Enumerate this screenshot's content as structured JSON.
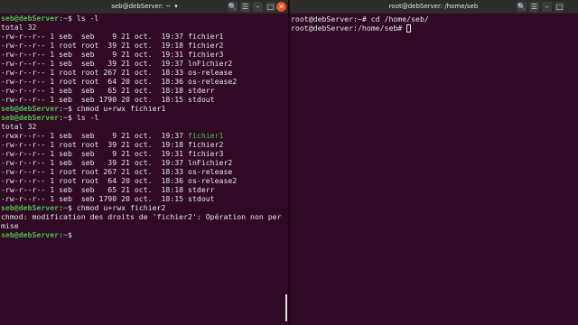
{
  "left_window": {
    "title": "seb@debServer: ~",
    "title_arrow": "▾",
    "buttons": [
      "🔍",
      "☰",
      "–",
      "□"
    ]
  },
  "right_window": {
    "title": "root@debServer: /home/seb",
    "buttons": [
      "🔍",
      "☰",
      "–",
      "□"
    ],
    "close": "✕"
  },
  "left_terminal": {
    "lines": [
      {
        "user": "seb@debServer",
        "path": "~",
        "cmd": "$ ls -l"
      },
      {
        "text": "total 32"
      },
      {
        "text": "-rw-r--r-- 1 seb  seb    9 21 oct.  19:37 fichier1"
      },
      {
        "text": "-rw-r--r-- 1 root root  39 21 oct.  19:18 fichier2"
      },
      {
        "text": "-rw-r--r-- 1 seb  seb    9 21 oct.  19:31 fichier3"
      },
      {
        "text": "-rw-r--r-- 1 seb  seb   39 21 oct.  19:37 lnFichier2"
      },
      {
        "text": "-rw-r--r-- 1 root root 267 21 oct.  18:33 os-release"
      },
      {
        "text": "-rw-r--r-- 1 root root  64 20 oct.  18:36 os-release2"
      },
      {
        "text": "-rw-r--r-- 1 seb  seb   65 21 oct.  18:18 stderr"
      },
      {
        "text": "-rw-r--r-- 1 seb  seb 1790 20 oct.  18:15 stdout"
      },
      {
        "user": "seb@debServer",
        "path": "~",
        "cmd": "$ chmod u+rwx fichier1"
      },
      {
        "user": "seb@debServer",
        "path": "~",
        "cmd": "$ ls -l"
      },
      {
        "text": "total 32"
      },
      {
        "text": "-rwxr--r-- 1 seb  seb    9 21 oct.  19:37 ",
        "highlight": "fichier1"
      },
      {
        "text": "-rw-r--r-- 1 root root  39 21 oct.  19:18 fichier2"
      },
      {
        "text": "-rw-r--r-- 1 seb  seb    9 21 oct.  19:31 fichier3"
      },
      {
        "text": "-rw-r--r-- 1 seb  seb   39 21 oct.  19:37 lnFichier2"
      },
      {
        "text": "-rw-r--r-- 1 root root 267 21 oct.  18:33 os-release"
      },
      {
        "text": "-rw-r--r-- 1 root root  64 20 oct.  18:36 os-release2"
      },
      {
        "text": "-rw-r--r-- 1 seb  seb   65 21 oct.  18:18 stderr"
      },
      {
        "text": "-rw-r--r-- 1 seb  seb 1790 20 oct.  18:15 stdout"
      },
      {
        "user": "seb@debServer",
        "path": "~",
        "cmd": "$ chmod u+rwx fichier2"
      },
      {
        "text": "chmod: modification des droits de 'fichier2': Opération non per"
      },
      {
        "text": "mise"
      },
      {
        "user": "seb@debServer",
        "path": "~",
        "cmd": "$"
      }
    ]
  },
  "right_terminal": {
    "lines": [
      {
        "text": "root@debServer:~# cd /home/seb/"
      },
      {
        "text": "root@debServer:/home/seb# ",
        "caret": true
      }
    ]
  }
}
